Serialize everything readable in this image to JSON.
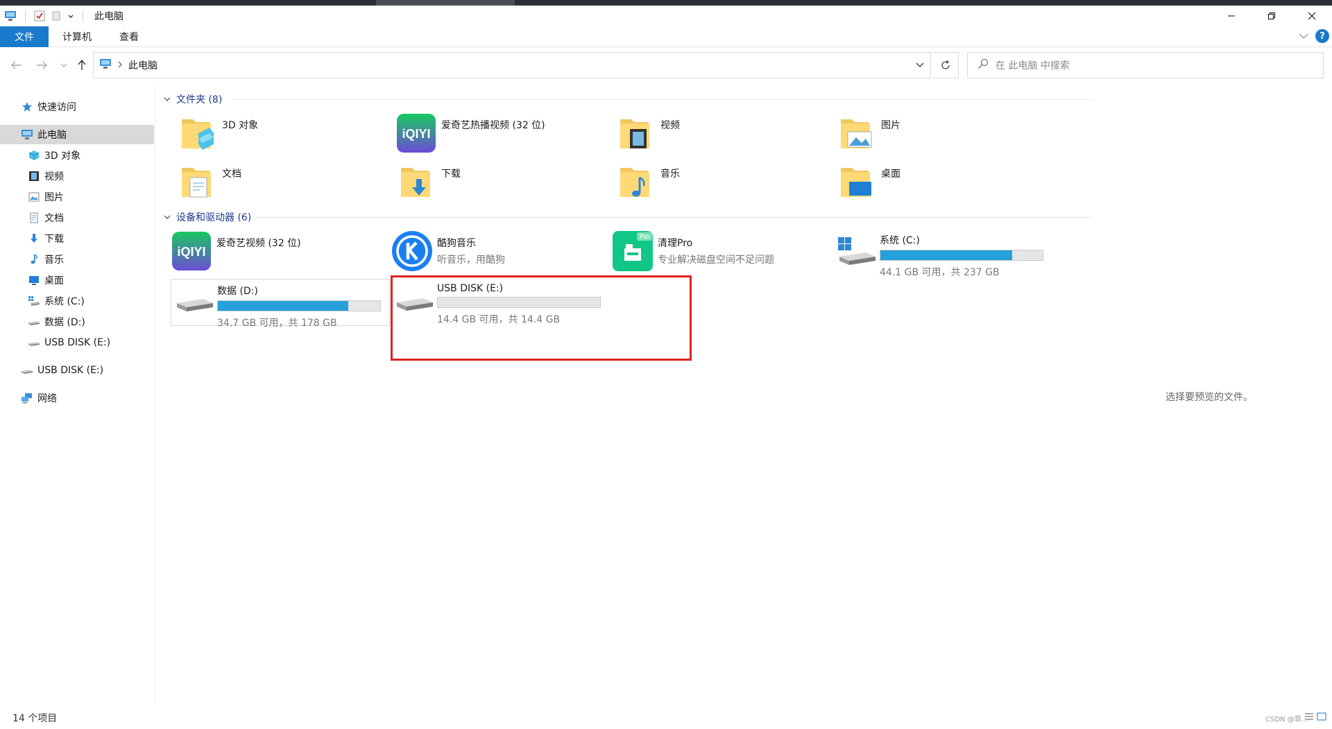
{
  "window": {
    "title": "此电脑"
  },
  "ribbon": {
    "tabs": [
      "文件",
      "计算机",
      "查看"
    ]
  },
  "address": {
    "crumb": "此电脑"
  },
  "search": {
    "placeholder": "在 此电脑 中搜索"
  },
  "sidebar": {
    "items": [
      {
        "label": "快速访问",
        "icon": "star-icon"
      },
      {
        "label": "此电脑",
        "icon": "computer-icon",
        "selected": true
      },
      {
        "label": "3D 对象",
        "icon": "3d-objects-icon"
      },
      {
        "label": "视频",
        "icon": "video-icon"
      },
      {
        "label": "图片",
        "icon": "pictures-icon"
      },
      {
        "label": "文档",
        "icon": "documents-icon"
      },
      {
        "label": "下载",
        "icon": "download-icon"
      },
      {
        "label": "音乐",
        "icon": "music-icon"
      },
      {
        "label": "桌面",
        "icon": "desktop-icon"
      },
      {
        "label": "系统 (C:)",
        "icon": "system-drive-icon"
      },
      {
        "label": "数据 (D:)",
        "icon": "drive-icon"
      },
      {
        "label": "USB DISK (E:)",
        "icon": "usb-drive-icon"
      },
      {
        "label": "USB DISK (E:)",
        "icon": "usb-drive-icon"
      },
      {
        "label": "网络",
        "icon": "network-icon"
      }
    ]
  },
  "folders": {
    "header": "文件夹 (8)",
    "items": [
      {
        "name": "3D 对象",
        "icon": "3d-objects-folder-icon"
      },
      {
        "name": "爱奇艺热播视频 (32 位)",
        "icon": "iqiyi-icon"
      },
      {
        "name": "视频",
        "icon": "video-folder-icon"
      },
      {
        "name": "图片",
        "icon": "pictures-folder-icon"
      },
      {
        "name": "文档",
        "icon": "documents-folder-icon"
      },
      {
        "name": "下载",
        "icon": "downloads-folder-icon"
      },
      {
        "name": "音乐",
        "icon": "music-folder-icon"
      },
      {
        "name": "桌面",
        "icon": "desktop-folder-icon"
      }
    ]
  },
  "devices": {
    "header": "设备和驱动器 (6)",
    "apps": [
      {
        "name": "爱奇艺视频 (32 位)",
        "sub": "",
        "icon": "iqiyi-icon"
      },
      {
        "name": "酷狗音乐",
        "sub": "听音乐，用酷狗",
        "icon": "kugou-icon"
      },
      {
        "name": "清理Pro",
        "sub": "专业解决磁盘空间不足问题",
        "icon": "cleaner-pro-icon"
      }
    ],
    "drives": [
      {
        "name": "系统 (C:)",
        "free": "44.1 GB 可用，共 237 GB",
        "used_fraction": 0.814
      },
      {
        "name": "数据 (D:)",
        "free": "34.7 GB 可用，共 178 GB",
        "used_fraction": 0.805
      },
      {
        "name": "USB DISK (E:)",
        "free": "14.4 GB 可用，共 14.4 GB",
        "used_fraction": 0.0
      }
    ]
  },
  "preview": {
    "text": "选择要预览的文件。"
  },
  "status": {
    "count": "14 个项目"
  },
  "watermark": "CSDN @菲…",
  "colors": {
    "accent": "#1979ca",
    "bar": "#26a0da",
    "highlight": "#e02020"
  }
}
